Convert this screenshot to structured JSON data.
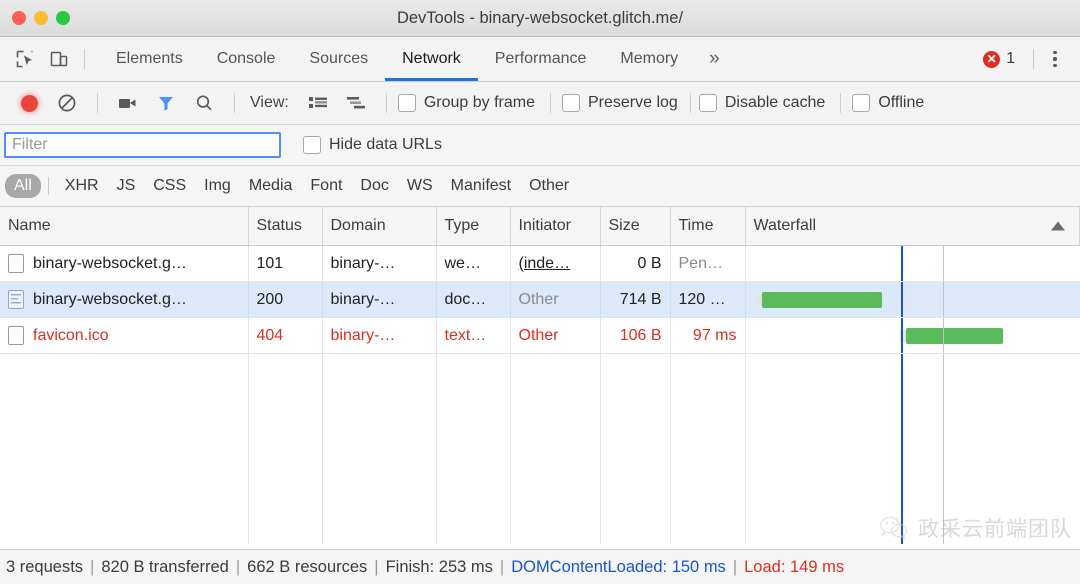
{
  "window": {
    "title": "DevTools - binary-websocket.glitch.me/",
    "traffic_lights": [
      "close",
      "minimize",
      "zoom"
    ]
  },
  "tabstrip": {
    "inspect_icon": "inspect-element-icon",
    "device_icon": "device-toolbar-icon",
    "tabs": [
      {
        "label": "Elements",
        "active": false
      },
      {
        "label": "Console",
        "active": false
      },
      {
        "label": "Sources",
        "active": false
      },
      {
        "label": "Network",
        "active": true
      },
      {
        "label": "Performance",
        "active": false
      },
      {
        "label": "Memory",
        "active": false
      }
    ],
    "more_label": "»",
    "error_count": "1",
    "menu_icon": "kebab-menu-icon",
    "accent_color": "#1a73e8",
    "error_color": "#d93025"
  },
  "toolbar": {
    "record_title": "record-button",
    "clear_title": "clear-button",
    "capture_screenshots_title": "camera-icon",
    "filter_title": "filter-icon",
    "search_title": "search-icon",
    "view_label": "View:",
    "view_list_title": "list-view-icon",
    "view_waterfall_title": "waterfall-view-icon",
    "checkboxes": [
      {
        "label": "Group by frame",
        "checked": false
      },
      {
        "label": "Preserve log",
        "checked": false
      },
      {
        "label": "Disable cache",
        "checked": false
      },
      {
        "label": "Offline",
        "checked": false
      }
    ]
  },
  "filter_row": {
    "input_value": "",
    "input_placeholder": "Filter",
    "hide_data_urls_label": "Hide data URLs",
    "hide_data_urls_checked": false
  },
  "type_filters": {
    "items": [
      {
        "label": "All",
        "active": true
      },
      {
        "label": "XHR",
        "active": false
      },
      {
        "label": "JS",
        "active": false
      },
      {
        "label": "CSS",
        "active": false
      },
      {
        "label": "Img",
        "active": false
      },
      {
        "label": "Media",
        "active": false
      },
      {
        "label": "Font",
        "active": false
      },
      {
        "label": "Doc",
        "active": false
      },
      {
        "label": "WS",
        "active": false
      },
      {
        "label": "Manifest",
        "active": false
      },
      {
        "label": "Other",
        "active": false
      }
    ]
  },
  "table": {
    "columns": [
      "Name",
      "Status",
      "Domain",
      "Type",
      "Initiator",
      "Size",
      "Time",
      "Waterfall"
    ],
    "sort_column": "Waterfall",
    "sort_direction": "ascending",
    "rows": [
      {
        "name": "binary-websocket.g…",
        "status": "101",
        "domain": "binary-…",
        "type": "we…",
        "initiator": "(inde…",
        "size": "0 B",
        "time": "Pen…",
        "selected": false,
        "error": false,
        "icon": "file-icon",
        "waterfall": {
          "visible": false,
          "left_pct": 0,
          "width_pct": 0
        }
      },
      {
        "name": "binary-websocket.g…",
        "status": "200",
        "domain": "binary-…",
        "type": "doc…",
        "initiator": "Other",
        "size": "714 B",
        "time": "120 …",
        "selected": true,
        "error": false,
        "icon": "document-icon",
        "waterfall": {
          "visible": true,
          "left_pct": 5,
          "width_pct": 36
        }
      },
      {
        "name": "favicon.ico",
        "status": "404",
        "domain": "binary-…",
        "type": "text…",
        "initiator": "Other",
        "size": "106 B",
        "time": "97 ms",
        "selected": false,
        "error": true,
        "icon": "file-icon",
        "waterfall": {
          "visible": true,
          "left_pct": 48,
          "width_pct": 29
        }
      }
    ],
    "waterfall_markers": [
      {
        "name": "dom-content-loaded-line",
        "color": "#1a56c4",
        "left_pct": 46.5
      },
      {
        "name": "load-line",
        "color": "#c3c3c3",
        "left_pct": 59
      }
    ]
  },
  "watermark": {
    "icon": "wechat-icon",
    "text": "政采云前端团队"
  },
  "statusbar": {
    "requests": "3 requests",
    "transferred": "820 B transferred",
    "resources": "662 B resources",
    "finish": "Finish: 253 ms",
    "dom_content_loaded": "DOMContentLoaded: 150 ms",
    "load": "Load: 149 ms",
    "separator": "|",
    "dom_color": "#1a56c4",
    "load_color": "#d93025"
  }
}
